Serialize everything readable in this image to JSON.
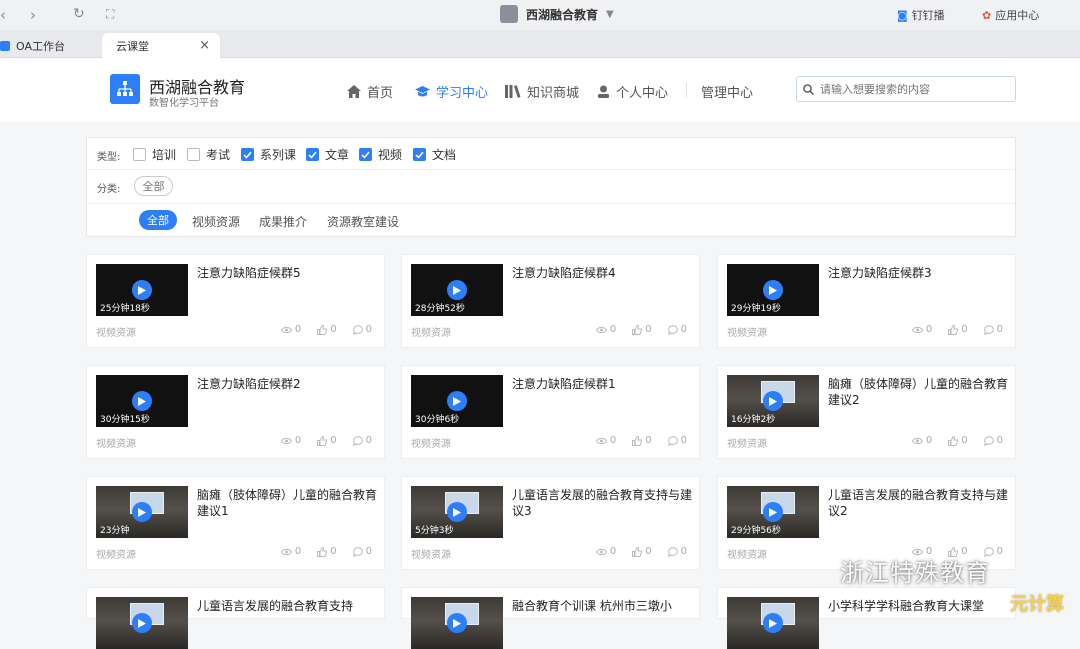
{
  "browser": {
    "window_title": "西湖融合教育",
    "right_items": [
      {
        "label": "钉钉播",
        "icon": "dingtalk-icon"
      },
      {
        "label": "应用中心",
        "icon": "app-center-icon"
      }
    ]
  },
  "tabs": [
    {
      "label": "OA工作台",
      "active": false
    },
    {
      "label": "云课堂",
      "active": true
    }
  ],
  "site": {
    "title": "西湖融合教育",
    "subtitle": "数智化学习平台",
    "nav": [
      {
        "label": "首页",
        "icon": "home-icon"
      },
      {
        "label": "学习中心",
        "icon": "graduation-cap-icon",
        "active": true
      },
      {
        "label": "知识商城",
        "icon": "books-icon"
      },
      {
        "label": "个人中心",
        "icon": "user-icon"
      },
      {
        "label": "管理中心"
      }
    ],
    "search_placeholder": "请输入想要搜索的内容"
  },
  "filters": {
    "type_label": "类型:",
    "types": [
      {
        "label": "培训",
        "checked": false
      },
      {
        "label": "考试",
        "checked": false
      },
      {
        "label": "系列课",
        "checked": true
      },
      {
        "label": "文章",
        "checked": true
      },
      {
        "label": "视频",
        "checked": true
      },
      {
        "label": "文档",
        "checked": true
      }
    ],
    "category_label": "分类:",
    "category_all": "全部",
    "subtabs": [
      "全部",
      "视频资源",
      "成果推介",
      "资源教室建设"
    ]
  },
  "cards": [
    {
      "title": "注意力缺陷症候群5",
      "duration": "25分钟18秒",
      "type": "视频资源",
      "views": "0",
      "likes": "0",
      "comments": "0",
      "photo": false
    },
    {
      "title": "注意力缺陷症候群4",
      "duration": "28分钟52秒",
      "type": "视频资源",
      "views": "0",
      "likes": "0",
      "comments": "0",
      "photo": false
    },
    {
      "title": "注意力缺陷症候群3",
      "duration": "29分钟19秒",
      "type": "视频资源",
      "views": "0",
      "likes": "0",
      "comments": "0",
      "photo": false
    },
    {
      "title": "注意力缺陷症候群2",
      "duration": "30分钟15秒",
      "type": "视频资源",
      "views": "0",
      "likes": "0",
      "comments": "0",
      "photo": false
    },
    {
      "title": "注意力缺陷症候群1",
      "duration": "30分钟6秒",
      "type": "视频资源",
      "views": "0",
      "likes": "0",
      "comments": "0",
      "photo": false
    },
    {
      "title": "脑瘫（肢体障碍）儿童的融合教育建议2",
      "duration": "16分钟2秒",
      "type": "视频资源",
      "views": "0",
      "likes": "0",
      "comments": "0",
      "photo": true
    },
    {
      "title": "脑瘫（肢体障碍）儿童的融合教育建议1",
      "duration": "23分钟",
      "type": "视频资源",
      "views": "0",
      "likes": "0",
      "comments": "0",
      "photo": true
    },
    {
      "title": "儿童语言发展的融合教育支持与建议3",
      "duration": "5分钟3秒",
      "type": "视频资源",
      "views": "0",
      "likes": "0",
      "comments": "0",
      "photo": true
    },
    {
      "title": "儿童语言发展的融合教育支持与建议2",
      "duration": "29分钟56秒",
      "type": "视频资源",
      "views": "0",
      "likes": "0",
      "comments": "0",
      "photo": true
    },
    {
      "title": "儿童语言发展的融合教育支持",
      "duration": "",
      "type": "",
      "views": "",
      "likes": "",
      "comments": "",
      "photo": true
    },
    {
      "title": "融合教育个训课 杭州市三墩小",
      "duration": "",
      "type": "",
      "views": "",
      "likes": "",
      "comments": "",
      "photo": true
    },
    {
      "title": "小学科学学科融合教育大课堂",
      "duration": "",
      "type": "",
      "views": "",
      "likes": "",
      "comments": "",
      "photo": true
    }
  ],
  "watermark": {
    "text": "浙江特殊教育",
    "corner": "元计算"
  },
  "colors": {
    "accent": "#2d7ff9",
    "page_bg": "#f5f6f8"
  }
}
